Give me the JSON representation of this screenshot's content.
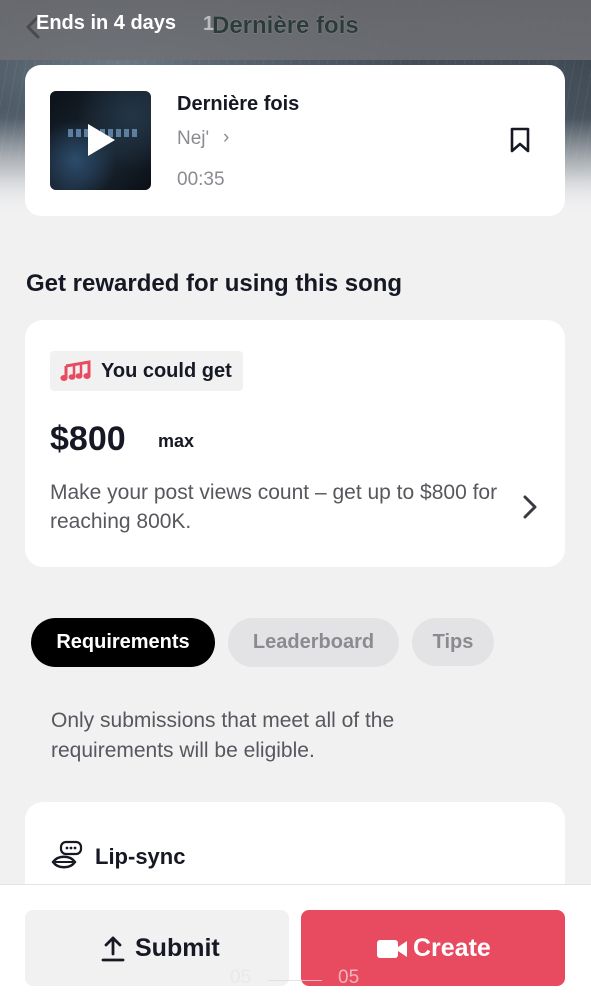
{
  "header": {
    "ends_label": "Ends in 4 days",
    "stats_label": "1",
    "title": "Dernière fois"
  },
  "song": {
    "title": "Dernière fois",
    "artist": "Nej'",
    "artist_chevron": "›",
    "duration": "00:35"
  },
  "section": {
    "heading": "Get rewarded for using this song"
  },
  "reward": {
    "chip_label": "You could get",
    "amount": "$800",
    "amount_suffix": "max",
    "description": "Make your post views count – get up to $800 for reaching 800K."
  },
  "tabs": [
    {
      "label": "Requirements",
      "active": true
    },
    {
      "label": "Leaderboard",
      "active": false
    },
    {
      "label": "Tips",
      "active": false
    }
  ],
  "requirements": {
    "description": "Only submissions that meet all of the requirements will be eligible.",
    "items": [
      {
        "label": "Lip-sync",
        "icon": "lip-sync-icon"
      }
    ]
  },
  "actions": {
    "submit_label": "Submit",
    "create_label": "Create"
  },
  "playback": {
    "current": "05",
    "total": "05"
  },
  "colors": {
    "accent": "#e84a5f",
    "active_tab": "#000000",
    "chip_bg": "#f1f1f2"
  }
}
